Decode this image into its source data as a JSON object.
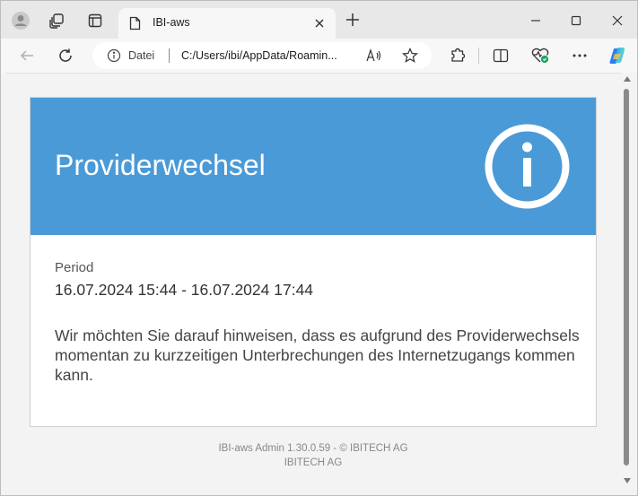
{
  "browser": {
    "tab_title": "IBI-aws",
    "address_scheme": "Datei",
    "address_url": "C:/Users/ibi/AppData/Roamin..."
  },
  "card": {
    "title": "Providerwechsel",
    "period_label": "Period",
    "period_value": "16.07.2024 15:44 - 16.07.2024 17:44",
    "message": "Wir möchten Sie darauf hinweisen, dass es aufgrund des Providerwechsels momentan zu kurzzeitigen Unterbrechungen des Internetzugangs kommen kann."
  },
  "footer": {
    "line1": "IBI-aws Admin 1.30.0.59   -   © IBITECH AG",
    "line2": "IBITECH AG"
  },
  "colors": {
    "header": "#4a9ad8",
    "card_bg": "#ffffff",
    "page_bg": "#f3f3f3"
  }
}
